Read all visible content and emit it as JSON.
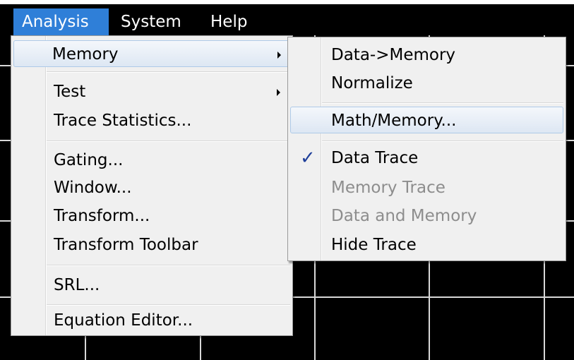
{
  "menubar": {
    "items": [
      {
        "label": "Analysis",
        "active": true
      },
      {
        "label": "System",
        "active": false
      },
      {
        "label": "Help",
        "active": false
      }
    ]
  },
  "analysis_menu": {
    "items": [
      {
        "label": "Memory",
        "submenu": true,
        "highlighted": true
      },
      {
        "label": "Test",
        "submenu": true
      },
      {
        "label": "Trace Statistics..."
      },
      {
        "label": "Gating..."
      },
      {
        "label": "Window..."
      },
      {
        "label": "Transform..."
      },
      {
        "label": "Transform Toolbar"
      },
      {
        "label": "SRL..."
      },
      {
        "label": "Equation Editor..."
      }
    ]
  },
  "memory_submenu": {
    "items": [
      {
        "label": "Data->Memory",
        "enabled": true
      },
      {
        "label": "Normalize",
        "enabled": true
      },
      {
        "label": "Math/Memory...",
        "enabled": true,
        "highlighted": true
      },
      {
        "label": "Data Trace",
        "enabled": true,
        "checked": true
      },
      {
        "label": "Memory Trace",
        "enabled": false
      },
      {
        "label": "Data and Memory",
        "enabled": false
      },
      {
        "label": "Hide Trace",
        "enabled": true
      }
    ],
    "check_glyph": "✓"
  },
  "colors": {
    "menubar_active": "#2f7fd8",
    "menu_background": "#f0f0f0",
    "disabled_text": "#8d8d8d",
    "checkmark": "#1f3f9a",
    "grid": "#d8d8d8",
    "background": "#000000"
  },
  "icons": {
    "submenu_arrow": "chevron-right-icon",
    "check": "checkmark-icon"
  }
}
